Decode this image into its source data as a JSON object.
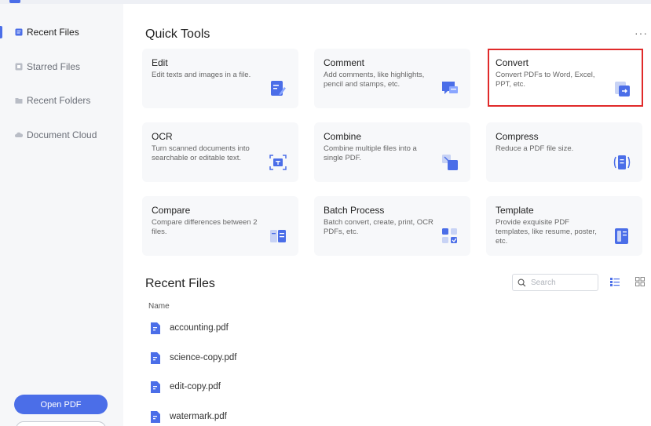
{
  "sidebar": {
    "items": [
      {
        "label": "Recent Files",
        "icon": "recent-files-icon"
      },
      {
        "label": "Starred Files",
        "icon": "star-icon"
      },
      {
        "label": "Recent Folders",
        "icon": "folder-icon"
      },
      {
        "label": "Document Cloud",
        "icon": "cloud-icon"
      }
    ],
    "open_pdf_label": "Open PDF"
  },
  "quick_tools": {
    "title": "Quick Tools",
    "more_label": "···",
    "tools": [
      {
        "title": "Edit",
        "desc": "Edit texts and images in a file.",
        "icon": "edit-icon"
      },
      {
        "title": "Comment",
        "desc": "Add comments, like highlights, pencil and stamps, etc.",
        "icon": "comment-icon"
      },
      {
        "title": "Convert",
        "desc": "Convert PDFs to Word, Excel, PPT, etc.",
        "icon": "convert-icon"
      },
      {
        "title": "OCR",
        "desc": "Turn scanned documents into searchable or editable text.",
        "icon": "ocr-icon"
      },
      {
        "title": "Combine",
        "desc": "Combine multiple files into a single PDF.",
        "icon": "combine-icon"
      },
      {
        "title": "Compress",
        "desc": "Reduce a PDF file size.",
        "icon": "compress-icon"
      },
      {
        "title": "Compare",
        "desc": "Compare differences between 2 files.",
        "icon": "compare-icon"
      },
      {
        "title": "Batch Process",
        "desc": "Batch convert, create, print, OCR PDFs, etc.",
        "icon": "batch-icon"
      },
      {
        "title": "Template",
        "desc": "Provide exquisite PDF templates, like resume, poster, etc.",
        "icon": "template-icon"
      }
    ]
  },
  "recent_files": {
    "title": "Recent Files",
    "search_placeholder": "Search",
    "column_name": "Name",
    "files": [
      "accounting.pdf",
      "science-copy.pdf",
      "edit-copy.pdf",
      "watermark.pdf"
    ]
  },
  "colors": {
    "accent": "#4b6ee8",
    "highlight": "#e02a2a",
    "sidebar_bg": "#f6f7f9",
    "card_bg": "#f7f8fa"
  }
}
